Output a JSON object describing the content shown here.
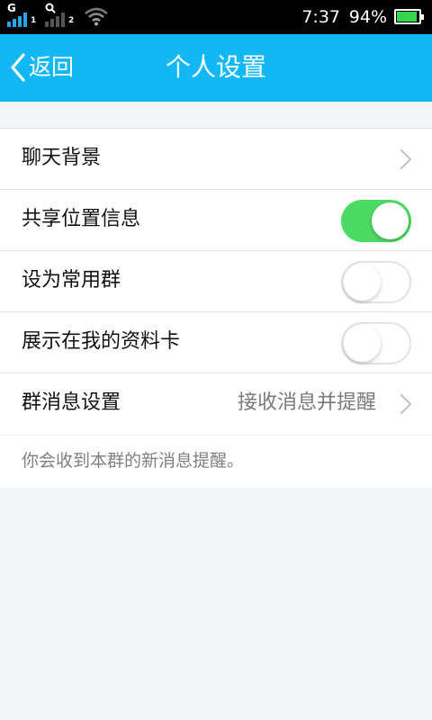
{
  "status_bar": {
    "sim1_network": "G",
    "sim1_number": "1",
    "sim2_number": "2",
    "time": "7:37",
    "battery_percent": "94%",
    "battery_level": 0.94,
    "icons": [
      "signal-icon",
      "wifi-icon",
      "battery-icon"
    ]
  },
  "header": {
    "back_label": "返回",
    "title": "个人设置"
  },
  "settings": {
    "items": [
      {
        "label": "聊天背景",
        "type": "link"
      },
      {
        "label": "共享位置信息",
        "type": "toggle",
        "on": true
      },
      {
        "label": "设为常用群",
        "type": "toggle",
        "on": false
      },
      {
        "label": "展示在我的资料卡",
        "type": "toggle",
        "on": false
      },
      {
        "label": "群消息设置",
        "type": "link",
        "value": "接收消息并提醒"
      }
    ],
    "note": "你会收到本群的新消息提醒。"
  },
  "colors": {
    "header": "#12b7f5",
    "toggle_on": "#4cd964",
    "background": "#f4f5f7"
  }
}
